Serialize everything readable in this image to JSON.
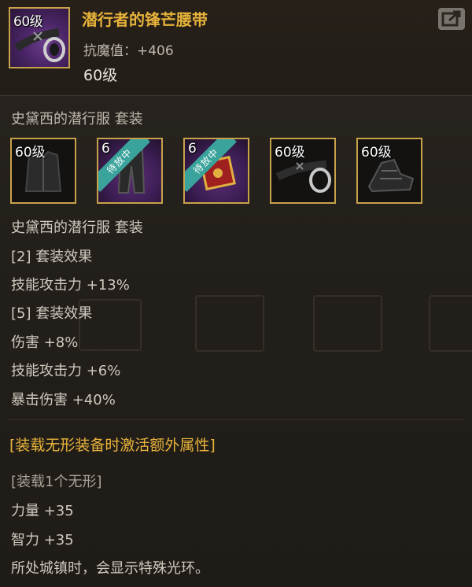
{
  "item": {
    "icon_level": "60级",
    "title": "潜行者的锋芒腰带",
    "stat_label": "抗魔值：+406",
    "level": "60级"
  },
  "set": {
    "name_top": "史黛西的潜行服 套装",
    "slots": [
      {
        "level": "60级",
        "ribbon": "",
        "icon": "armor-coat-icon",
        "style": "dark"
      },
      {
        "level": "6",
        "ribbon": "待放中",
        "icon": "armor-pants-icon",
        "style": "purple"
      },
      {
        "level": "6",
        "ribbon": "待放中",
        "icon": "scroll-accessory-icon",
        "style": "purple"
      },
      {
        "level": "60级",
        "ribbon": "",
        "icon": "belt-icon",
        "style": "dark"
      },
      {
        "level": "60级",
        "ribbon": "",
        "icon": "boots-icon",
        "style": "dark"
      }
    ],
    "name_bottom": "史黛西的潜行服 套装",
    "effects": [
      "[2] 套装效果",
      "技能攻击力 +13%",
      "[5] 套装效果",
      "伤害 +8%",
      "技能攻击力 +6%",
      "暴击伤害 +40%"
    ]
  },
  "bonus": {
    "title": "[装载无形装备时激活额外属性]",
    "lines": [
      "[装载1个无形]",
      "力量 +35",
      "智力 +35",
      "所处城镇时，会显示特殊光环。"
    ]
  },
  "colors": {
    "gold": "#e8b33a",
    "frame": "#c8a24a",
    "ribbon": "#3aa39b"
  }
}
